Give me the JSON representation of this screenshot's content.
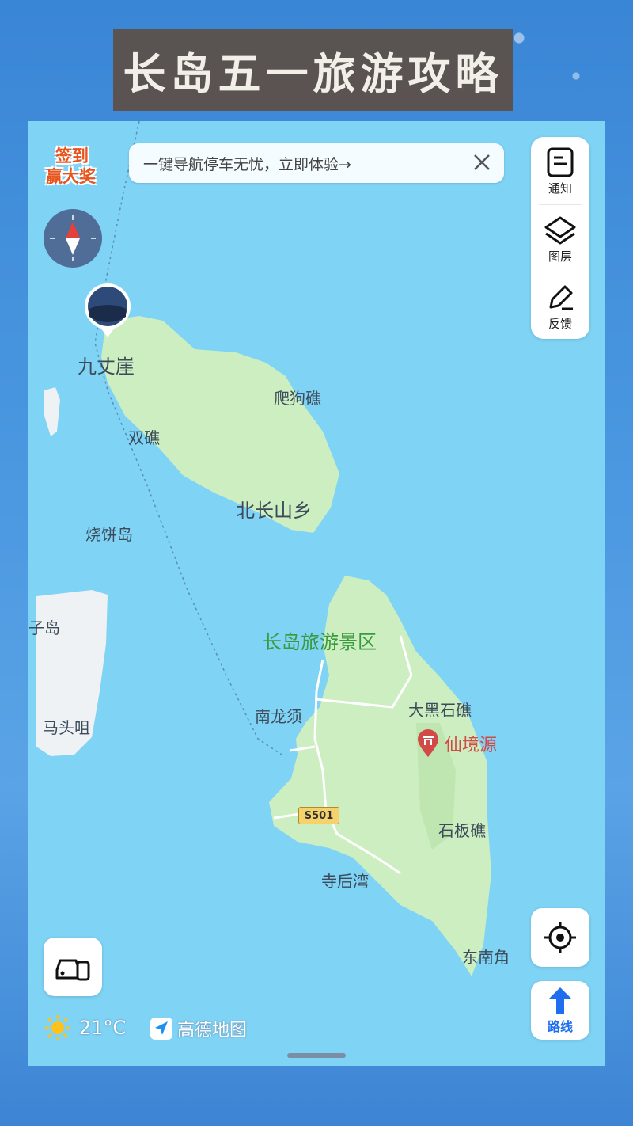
{
  "page_title": "长岛五一旅游攻略",
  "banner": {
    "text": "一键导航停车无忧，立即体验→"
  },
  "signin": {
    "line1": "签到",
    "line2": "赢大奖"
  },
  "toolbar": {
    "notice_label": "通知",
    "layers_label": "图层",
    "feedback_label": "反馈"
  },
  "route_label": "路线",
  "weather": {
    "temp": "21°C"
  },
  "logo": {
    "text": "高德地图"
  },
  "map_labels": {
    "jiuzhangya": "九丈崖",
    "pagouji": "爬狗礁",
    "shuangjiao": "双礁",
    "beichangshan": "北长山乡",
    "shaobingdao": "烧饼岛",
    "zidao": "子岛",
    "matouju": "马头咀",
    "changdao_scenic": "长岛旅游景区",
    "nanlongxu": "南龙须",
    "daheishijiao": "大黑石礁",
    "xianjingyuan": "仙境源",
    "road_s501": "S501",
    "shibanjiao": "石板礁",
    "sihouwan": "寺后湾",
    "dongnanjiao": "东南角"
  },
  "colors": {
    "sea": "#7fd3f5",
    "land": "#cdeec1",
    "accent_blue": "#1f6ef0",
    "poi_red": "#d24a48",
    "scenic_green": "#3a9a3e"
  }
}
